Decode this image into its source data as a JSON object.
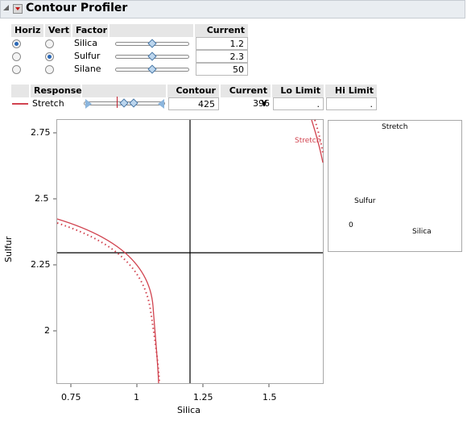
{
  "header": {
    "title": "Contour Profiler"
  },
  "factor_table": {
    "headers": {
      "horiz": "Horiz",
      "vert": "Vert",
      "factor": "Factor",
      "current_x": "Current X"
    },
    "rows": [
      {
        "factor": "Silica",
        "current_x": "1.2",
        "horiz": true,
        "vert": false,
        "slider_fraction": 0.5
      },
      {
        "factor": "Sulfur",
        "current_x": "2.3",
        "horiz": false,
        "vert": true,
        "slider_fraction": 0.5
      },
      {
        "factor": "Silane",
        "current_x": "50",
        "horiz": false,
        "vert": false,
        "slider_fraction": 0.5
      }
    ]
  },
  "response_table": {
    "headers": {
      "response": "Response",
      "contour": "Contour",
      "current_y": "Current Y",
      "lo_limit": "Lo Limit",
      "hi_limit": "Hi Limit"
    },
    "row": {
      "name": "Stretch",
      "contour": "425",
      "current_y": "396",
      "lo_limit": ".",
      "hi_limit": ".",
      "line_color": "#d1434f",
      "range_low_fraction": 0.43,
      "range_high_fraction": 0.53,
      "marker_fraction": 0.48
    }
  },
  "contour_plot": {
    "xlabel": "Silica",
    "ylabel": "Sulfur",
    "x_ticks": [
      "0.75",
      "1",
      "1.25",
      "1.5"
    ],
    "y_ticks": [
      "2.75",
      "2.5",
      "2.25",
      "2"
    ],
    "curve_label": "Stretch",
    "crosshair": {
      "x": 1.2,
      "y": 2.3
    },
    "curve_color": "#d1434f"
  },
  "surface_plot": {
    "title": "Stretch",
    "axis_labels": {
      "x": "Silica",
      "y": "Sulfur",
      "z0": "0"
    },
    "surface_color": "#d1434f"
  }
}
